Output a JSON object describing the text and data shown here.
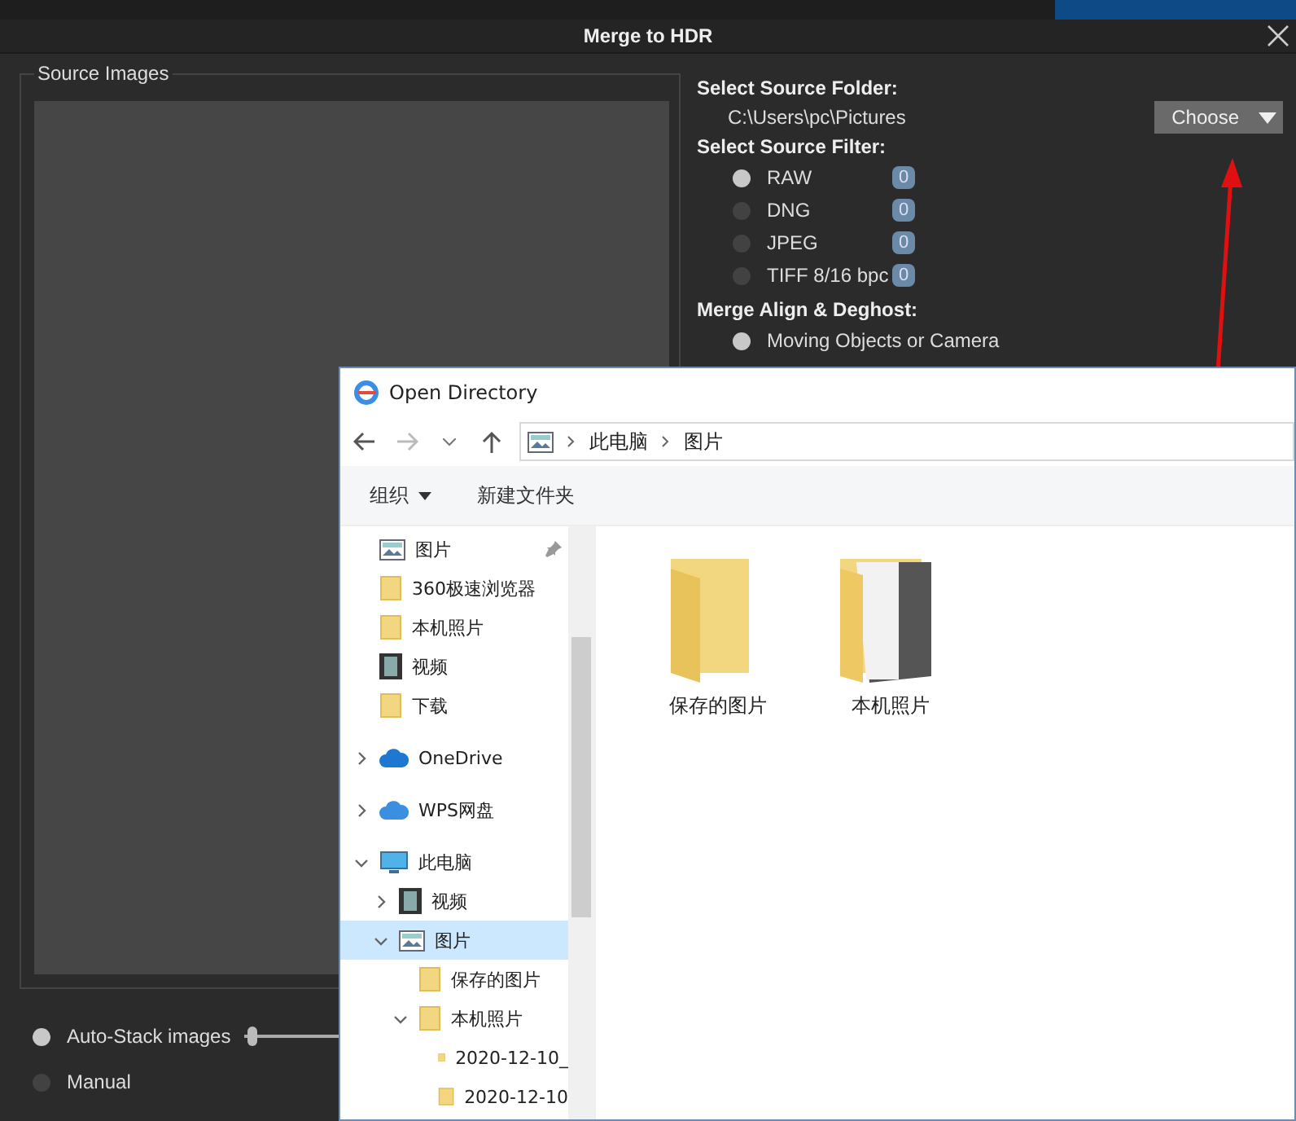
{
  "dialog": {
    "title": "Merge to HDR"
  },
  "source_images": {
    "legend": "Source Images"
  },
  "source_folder": {
    "label": "Select Source Folder:",
    "path": "C:\\Users\\pc\\Pictures",
    "button": "Choose"
  },
  "source_filter": {
    "label": "Select Source Filter:",
    "options": [
      {
        "label": "RAW",
        "selected": true,
        "count": "0"
      },
      {
        "label": "DNG",
        "selected": false,
        "count": "0"
      },
      {
        "label": "JPEG",
        "selected": false,
        "count": "0"
      },
      {
        "label": "TIFF 8/16 bpc",
        "selected": false,
        "count": "0"
      }
    ]
  },
  "merge_align": {
    "label": "Merge Align & Deghost:",
    "options": [
      {
        "label": "Moving Objects or Camera",
        "selected": true
      }
    ]
  },
  "stack_modes": [
    {
      "label": "Auto-Stack images",
      "selected": true,
      "slider": {
        "level": 0.05
      }
    },
    {
      "label": "Manual",
      "selected": false
    }
  ],
  "open_directory": {
    "title": "Open Directory",
    "breadcrumb": [
      "此电脑",
      "图片"
    ],
    "toolbar": {
      "organize": "组织",
      "new_folder": "新建文件夹"
    },
    "tree": [
      {
        "label": "图片",
        "kind": "pictures",
        "pinned": true,
        "selected": false
      },
      {
        "label": "360极速浏览器",
        "kind": "folder",
        "selected": false
      },
      {
        "label": "本机照片",
        "kind": "folder",
        "selected": false
      },
      {
        "label": "视频",
        "kind": "video",
        "selected": false
      },
      {
        "label": "下载",
        "kind": "folder",
        "selected": false
      },
      {
        "label": "OneDrive",
        "kind": "cloud",
        "expanded": false,
        "selected": false
      },
      {
        "label": "WPS网盘",
        "kind": "cloud2",
        "expanded": false,
        "selected": false
      },
      {
        "label": "此电脑",
        "kind": "computer",
        "expanded": true,
        "selected": false,
        "children": [
          {
            "label": "视频",
            "kind": "video",
            "expanded": false,
            "selected": false
          },
          {
            "label": "图片",
            "kind": "pictures",
            "expanded": true,
            "selected": true,
            "children": [
              {
                "label": "保存的图片",
                "kind": "folder",
                "selected": false
              },
              {
                "label": "本机照片",
                "kind": "folder",
                "expanded": true,
                "selected": false,
                "children": [
                  {
                    "label": "2020-12-10_",
                    "kind": "folder",
                    "selected": false
                  },
                  {
                    "label": "2020-12-10",
                    "kind": "folder",
                    "selected": false
                  }
                ]
              }
            ]
          }
        ]
      }
    ],
    "files": [
      {
        "label": "保存的图片",
        "kind": "folder"
      },
      {
        "label": "本机照片",
        "kind": "photo-folder"
      }
    ]
  }
}
